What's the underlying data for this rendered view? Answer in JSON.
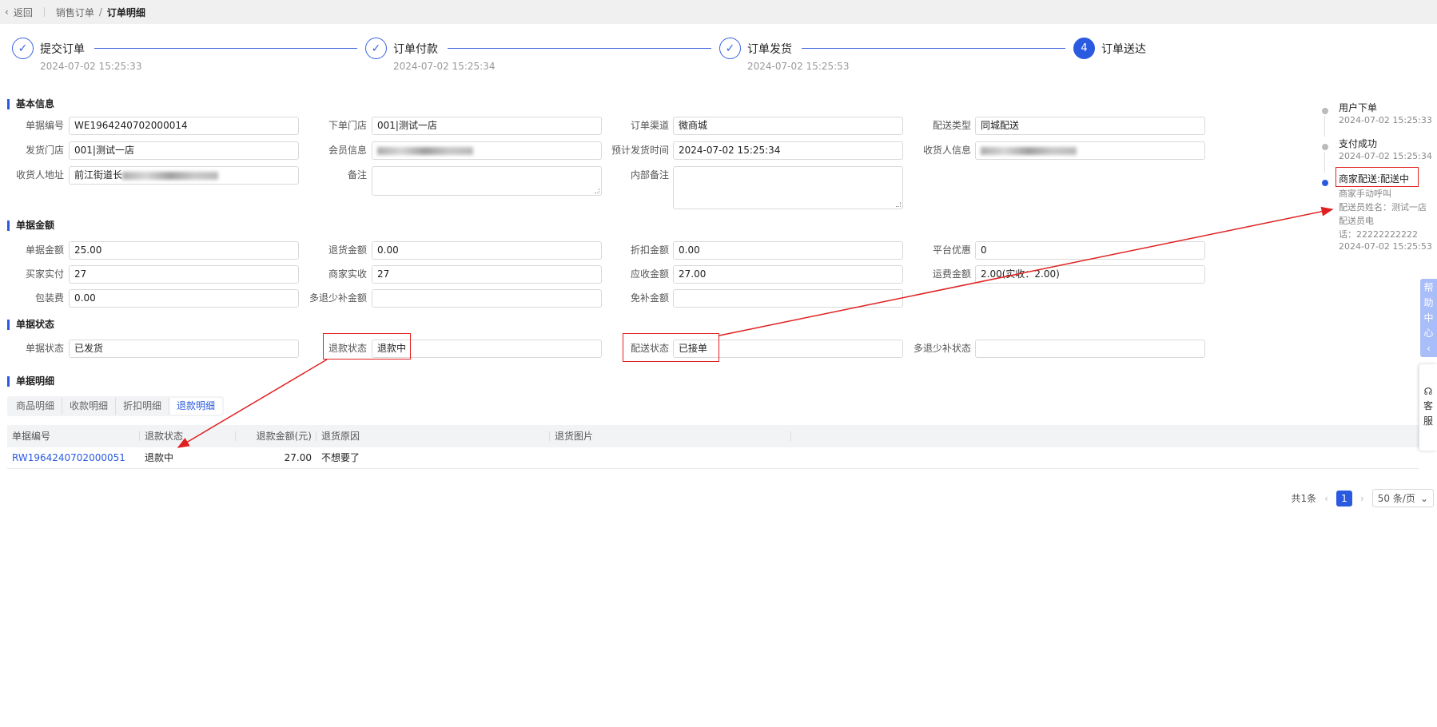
{
  "topbar": {
    "back": "返回",
    "crumb_parent": "销售订单",
    "crumb_current": "订单明细"
  },
  "steps": [
    {
      "label": "提交订单",
      "date": "2024-07-02 15:25:33",
      "icon": "check-icon",
      "mark": "✓"
    },
    {
      "label": "订单付款",
      "date": "2024-07-02 15:25:34",
      "icon": "check-icon",
      "mark": "✓"
    },
    {
      "label": "订单发货",
      "date": "2024-07-02 15:25:53",
      "icon": "check-icon",
      "mark": "✓"
    },
    {
      "label": "订单送达",
      "date": "",
      "icon": "step-number-icon",
      "mark": "4"
    }
  ],
  "sections": {
    "basic": "基本信息",
    "amount": "单据金额",
    "status": "单据状态",
    "detail": "单据明细"
  },
  "basic_fields": [
    {
      "label": "单据编号",
      "value": "WE1964240702000014"
    },
    {
      "label": "下单门店",
      "value": "001|测试一店"
    },
    {
      "label": "订单渠道",
      "value": "微商城"
    },
    {
      "label": "配送类型",
      "value": "同城配送"
    },
    {
      "label": "发货门店",
      "value": "001|测试一店"
    },
    {
      "label": "会员信息",
      "value": "",
      "blurred": true
    },
    {
      "label": "预计发货时间",
      "value": "2024-07-02 15:25:34"
    },
    {
      "label": "收货人信息",
      "value": "",
      "blurred": true
    },
    {
      "label": "收货人地址",
      "value": "前江街道长",
      "blurred": true
    },
    {
      "label": "备注",
      "value": "",
      "textarea": true
    },
    {
      "label": "内部备注",
      "value": "",
      "textarea": true,
      "tall": true
    }
  ],
  "amount_fields": [
    {
      "label": "单据金额",
      "value": "25.00"
    },
    {
      "label": "退货金额",
      "value": "0.00"
    },
    {
      "label": "折扣金额",
      "value": "0.00"
    },
    {
      "label": "平台优惠",
      "value": "0"
    },
    {
      "label": "买家实付",
      "value": "27"
    },
    {
      "label": "商家实收",
      "value": "27"
    },
    {
      "label": "应收金额",
      "value": "27.00"
    },
    {
      "label": "运费金额",
      "value": "2.00(实收：2.00)"
    },
    {
      "label": "包装费",
      "value": "0.00"
    },
    {
      "label": "多退少补金额",
      "value": ""
    },
    {
      "label": "免补金额",
      "value": ""
    }
  ],
  "status_fields": [
    {
      "label": "单据状态",
      "value": "已发货"
    },
    {
      "label": "退款状态",
      "value": "退款中"
    },
    {
      "label": "配送状态",
      "value": "已接单"
    },
    {
      "label": "多退少补状态",
      "value": ""
    }
  ],
  "tabs": [
    {
      "label": "商品明细"
    },
    {
      "label": "收款明细"
    },
    {
      "label": "折扣明细"
    },
    {
      "label": "退款明细",
      "active": true
    }
  ],
  "table": {
    "columns": [
      "单据编号",
      "退款状态",
      "退款金额(元)",
      "退货原因",
      "退货图片"
    ],
    "rows": [
      [
        "RW1964240702000051",
        "退款中",
        "27.00",
        "不想要了",
        ""
      ]
    ]
  },
  "pagination": {
    "total": "共1条",
    "page": "1",
    "size": "50 条/页"
  },
  "timeline": [
    {
      "title": "用户下单",
      "lines": [
        "2024-07-02 15:25:33"
      ]
    },
    {
      "title": "支付成功",
      "lines": [
        "2024-07-02 15:25:34"
      ]
    },
    {
      "title": "商家配送:配送中",
      "lines": [
        "商家手动呼叫",
        "配送员姓名：测试一店",
        "配送员电",
        "话：22222222222",
        "2024-07-02 15:25:53"
      ],
      "active": true
    }
  ],
  "help": {
    "label": "帮助中心",
    "chevron": "‹"
  },
  "service": {
    "label": "客服"
  },
  "colors": {
    "primary": "#2a5ae0",
    "annotation": "#e02020"
  }
}
